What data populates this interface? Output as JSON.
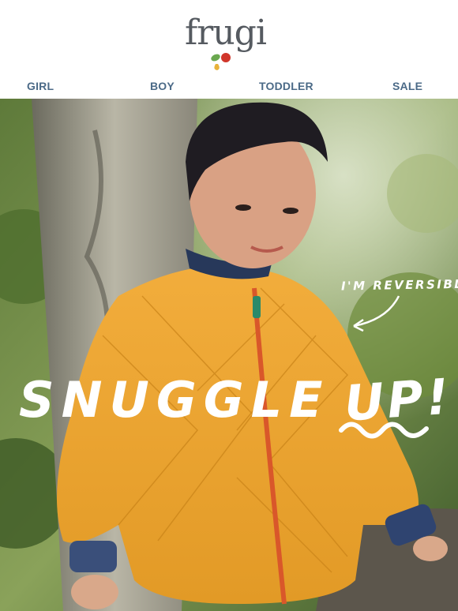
{
  "brand": {
    "name": "frugi",
    "colors": {
      "leaf_red": "#d0362b",
      "leaf_green": "#6aa84f",
      "leaf_yellow": "#e8b23a",
      "text": "#555a60"
    }
  },
  "nav": {
    "items": [
      {
        "label": "GIRL"
      },
      {
        "label": "BOY"
      },
      {
        "label": "TODDLER"
      },
      {
        "label": "SALE"
      }
    ],
    "color": "#4b6a87"
  },
  "hero": {
    "annotation": "I'M REVERSIBLE",
    "headline_part1": "SNUGGLE",
    "headline_part2": "UP!",
    "image_subject": "child in mustard quilted reversible jacket in a forest"
  }
}
